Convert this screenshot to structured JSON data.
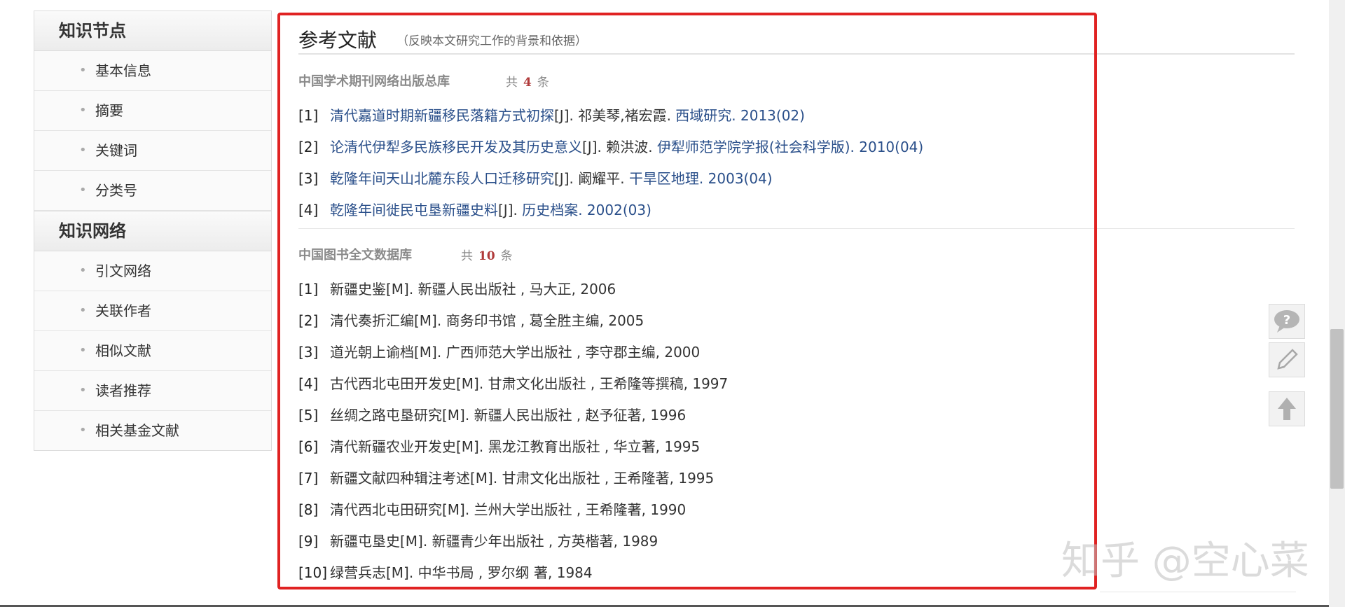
{
  "sidebar": {
    "section1_title": "知识节点",
    "section1_items": [
      "基本信息",
      "摘要",
      "关键词",
      "分类号"
    ],
    "section2_title": "知识网络",
    "section2_items": [
      "引文网络",
      "关联作者",
      "相似文献",
      "读者推荐",
      "相关基金文献"
    ]
  },
  "main": {
    "title": "参考文献",
    "subtitle": "（反映本文研究工作的背景和依据）",
    "db1": {
      "name": "中国学术期刊网络出版总库",
      "count_prefix": "共",
      "count": "4",
      "count_suffix": "条",
      "refs": [
        {
          "num": "[1]",
          "title": "清代嘉道时期新疆移民落籍方式初探",
          "type": "[J]. 祁美琴,褚宏霞. ",
          "source": "西域研究. 2013(02)"
        },
        {
          "num": "[2]",
          "title": "论清代伊犁多民族移民开发及其历史意义",
          "type": "[J]. 赖洪波. ",
          "source": "伊犁师范学院学报(社会科学版). 2010(04)"
        },
        {
          "num": "[3]",
          "title": "乾隆年间天山北麓东段人口迁移研究",
          "type": "[J]. 阚耀平. ",
          "source": "干旱区地理. 2003(04)"
        },
        {
          "num": "[4]",
          "title": "乾隆年间徙民屯垦新疆史料",
          "type": "[J]. ",
          "source": "历史档案. 2002(03)"
        }
      ]
    },
    "db2": {
      "name": "中国图书全文数据库",
      "count_prefix": "共",
      "count": "10",
      "count_suffix": "条",
      "refs": [
        {
          "num": "[1]",
          "text": "新疆史鉴[M]. 新疆人民出版社 , 马大正, 2006"
        },
        {
          "num": "[2]",
          "text": "清代奏折汇编[M]. 商务印书馆 , 葛全胜主编, 2005"
        },
        {
          "num": "[3]",
          "text": "道光朝上谕档[M]. 广西师范大学出版社 , 李守郡主编, 2000"
        },
        {
          "num": "[4]",
          "text": "古代西北屯田开发史[M]. 甘肃文化出版社 , 王希隆等撰稿, 1997"
        },
        {
          "num": "[5]",
          "text": "丝绸之路屯垦研究[M]. 新疆人民出版社 , 赵予征著, 1996"
        },
        {
          "num": "[6]",
          "text": "清代新疆农业开发史[M]. 黑龙江教育出版社 , 华立著, 1995"
        },
        {
          "num": "[7]",
          "text": "新疆文献四种辑注考述[M]. 甘肃文化出版社 , 王希隆著, 1995"
        },
        {
          "num": "[8]",
          "text": "清代西北屯田研究[M]. 兰州大学出版社 , 王希隆著, 1990"
        },
        {
          "num": "[9]",
          "text": "新疆屯垦史[M]. 新疆青少年出版社 , 方英楷著, 1989"
        },
        {
          "num": "[10]",
          "text": "绿营兵志[M]. 中华书局 , 罗尔纲 著, 1984"
        }
      ]
    }
  },
  "watermark": "知乎 @空心菜",
  "icons": {
    "feedback": "question-bubble-icon",
    "edit": "pencil-icon",
    "top": "arrow-up-icon"
  }
}
